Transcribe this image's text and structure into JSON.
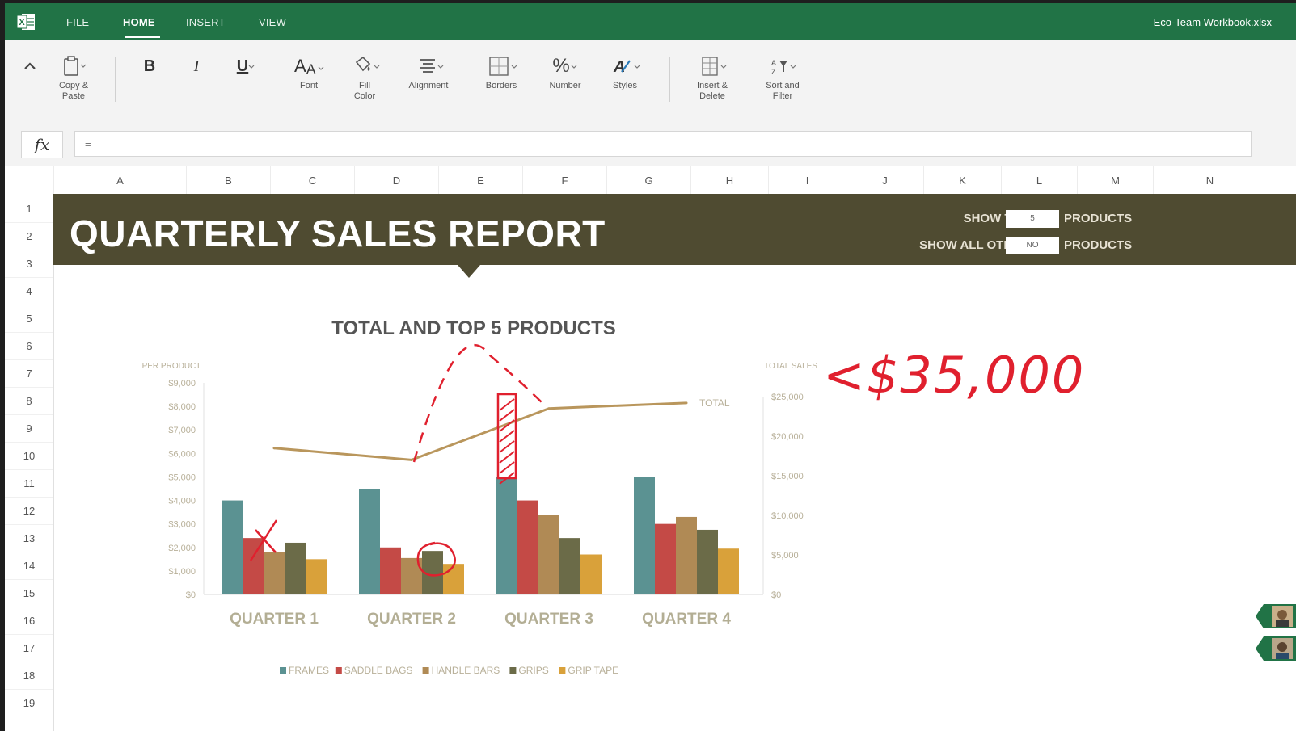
{
  "tabbar": {
    "tabs": [
      {
        "label": "FILE",
        "active": false
      },
      {
        "label": "HOME",
        "active": true
      },
      {
        "label": "INSERT",
        "active": false
      },
      {
        "label": "VIEW",
        "active": false
      }
    ],
    "workbook_name": "Eco-Team Workbook.xlsx",
    "colors": {
      "brand": "#217346"
    }
  },
  "ribbon": {
    "collapse_icon": "chevron-up-icon",
    "copy_paste": "Copy &\nPaste",
    "bold": "B",
    "italic": "I",
    "underline": "U",
    "font": "Font",
    "fill_color": "Fill\nColor",
    "alignment": "Alignment",
    "borders": "Borders",
    "number": "Number",
    "styles": "Styles",
    "insert_delete": "Insert &\nDelete",
    "sort_filter": "Sort and\nFilter"
  },
  "formula_bar": {
    "fx": "fx",
    "value": "="
  },
  "sheet": {
    "columns": [
      "A",
      "B",
      "C",
      "D",
      "E",
      "F",
      "G",
      "H",
      "I",
      "J",
      "K",
      "L",
      "M",
      "N"
    ],
    "rows": [
      "1",
      "2",
      "3",
      "4",
      "5",
      "6",
      "7",
      "8",
      "9",
      "10",
      "11",
      "12",
      "13",
      "14",
      "15",
      "16",
      "17",
      "18",
      "19"
    ]
  },
  "banner": {
    "title": "QUARTERLY SALES REPORT",
    "show_top_label": "SHOW TOP",
    "show_top_value": "5",
    "show_top_suffix": "PRODUCTS",
    "show_other_label": "SHOW ALL OTHER",
    "show_other_value": "NO",
    "show_other_suffix": "PRODUCTS",
    "color": "#4f4b31"
  },
  "annotation": {
    "text": "<$35,000",
    "color": "#e0202e"
  },
  "chart_data": {
    "type": "bar",
    "title": "TOTAL AND TOP 5 PRODUCTS",
    "ylabel": "PER PRODUCT",
    "y2label": "TOTAL SALES",
    "categories": [
      "QUARTER 1",
      "QUARTER 2",
      "QUARTER 3",
      "QUARTER 4"
    ],
    "ylim": [
      0,
      9000
    ],
    "y_ticks": [
      "$0",
      "$1,000",
      "$2,000",
      "$3,000",
      "$4,000",
      "$5,000",
      "$6,000",
      "$7,000",
      "$8,000",
      "$9,000"
    ],
    "y2lim": [
      0,
      25000
    ],
    "y2_ticks": [
      "$0",
      "$5,000",
      "$10,000",
      "$15,000",
      "$20,000",
      "$25,000"
    ],
    "series": [
      {
        "name": "FRAMES",
        "color": "#5b9292",
        "values": [
          4000,
          4500,
          5000,
          5000
        ]
      },
      {
        "name": "SADDLE BAGS",
        "color": "#c44a46",
        "values": [
          2400,
          2000,
          4000,
          3000
        ]
      },
      {
        "name": "HANDLE BARS",
        "color": "#b08a55",
        "values": [
          1800,
          1550,
          3400,
          3300
        ]
      },
      {
        "name": "GRIPS",
        "color": "#6b6b48",
        "values": [
          2200,
          1850,
          2400,
          2750
        ]
      },
      {
        "name": "GRIP TAPE",
        "color": "#d9a13a",
        "values": [
          1500,
          1300,
          1700,
          1950
        ]
      }
    ],
    "line": {
      "name": "TOTAL",
      "color": "#b9965c",
      "values": [
        18500,
        17000,
        23500,
        24200
      ]
    },
    "grid": false,
    "legend": "bottom"
  }
}
